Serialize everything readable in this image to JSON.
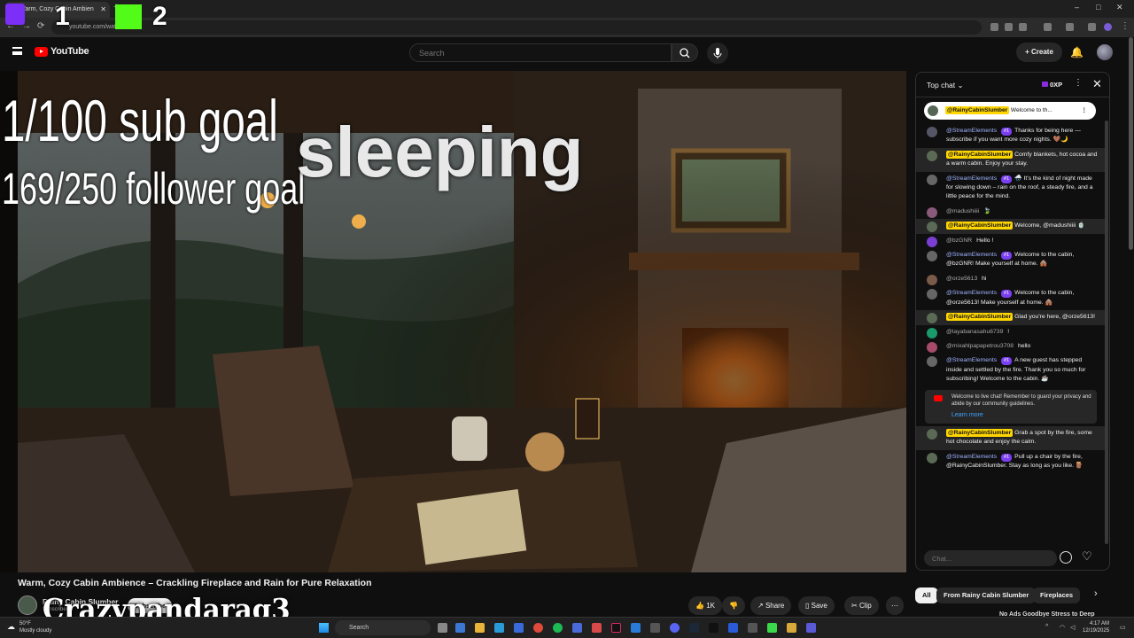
{
  "browser": {
    "tab_title": "Warm, Cozy Cabin Ambien",
    "url": "youtube.com/watch?v=...",
    "new_tab": "+",
    "window_controls": [
      "–",
      "□",
      "✕"
    ]
  },
  "overlay_top": {
    "twitch_count": "1",
    "kick_count": "2"
  },
  "youtube": {
    "logo_text": "YouTube",
    "search_placeholder": "Search",
    "create_label": "+ Create"
  },
  "video_overlay": {
    "sub_goal": "1/100 sub goal",
    "follower_goal": "169/250 follower goal",
    "status": "sleeping",
    "watermark": "Crazypandarag3"
  },
  "video": {
    "title": "Warm, Cozy Cabin Ambience – Crackling Fireplace and Rain for Pure Relaxation",
    "channel": "Rainy Cabin Slumber",
    "subscribers": "Subscribers",
    "subscribe_label": "Subscribe",
    "actions": {
      "likes": "1K",
      "share": "Share",
      "save": "Save",
      "clip": "Clip",
      "more": "⋯"
    }
  },
  "chat": {
    "header": "Top chat",
    "xp": "0XP",
    "pinned_author": "@RainyCabinSlumber",
    "pinned_text": "Welcome to th...",
    "messages": [
      {
        "author": "@StreamElements",
        "bot": true,
        "rank": "#1",
        "text": "Thanks for being here — subscribe if you want more cozy nights. 🤎🌙",
        "hl": false
      },
      {
        "author": "@RainyCabinSlumber",
        "owner": true,
        "text": "Comfy blankets, hot cocoa and a warm cabin. Enjoy your stay.",
        "hl": true
      },
      {
        "author": "@StreamElements",
        "bot": true,
        "rank": "#1",
        "text": "🌧️ It's the kind of night made for slowing down – rain on the roof, a steady fire, and a little peace for the mind.",
        "hl": false
      },
      {
        "author": "@madushiiii",
        "text": "🍃",
        "hl": false
      },
      {
        "author": "@RainyCabinSlumber",
        "owner": true,
        "text": "Welcome, @madushiiii 🍵",
        "hl": true
      },
      {
        "author": "@bzGNR",
        "text": "Hello !",
        "hl": false
      },
      {
        "author": "@StreamElements",
        "bot": true,
        "rank": "#1",
        "text": "Welcome to the cabin, @bzGNR! Make yourself at home. 🛖",
        "hl": false
      },
      {
        "author": "@orze5613",
        "text": "hi",
        "hl": false
      },
      {
        "author": "@StreamElements",
        "bot": true,
        "rank": "#1",
        "text": "Welcome to the cabin, @orze5613! Make yourself at home. 🛖",
        "hl": false
      },
      {
        "author": "@RainyCabinSlumber",
        "owner": true,
        "text": "Glad you're here, @orze5613!",
        "hl": true
      },
      {
        "author": "@layabanasahu6739",
        "text": "!",
        "hl": false
      },
      {
        "author": "@mixahlpapapetrou3708",
        "text": "hello",
        "hl": false
      },
      {
        "author": "@StreamElements",
        "bot": true,
        "rank": "#1",
        "text": "A new guest has stepped inside and settled by the fire. Thank you so much for subscribing! Welcome to the cabin. ☕",
        "hl": false
      }
    ],
    "notice": "Welcome to live chat! Remember to guard your privacy and abide by our community guidelines.",
    "notice_link": "Learn more",
    "messages2": [
      {
        "author": "@RainyCabinSlumber",
        "owner": true,
        "text": "Grab a spot by the fire, some hot chocolate and enjoy the calm.",
        "hl": true
      },
      {
        "author": "@StreamElements",
        "bot": true,
        "rank": "#1",
        "text": "Pull up a chair by the fire, @RainyCabinSlumber. Stay as long as you like. 🪵",
        "hl": false
      }
    ],
    "input_placeholder": "Chat..."
  },
  "chips": [
    "All",
    "From Rainy Cabin Slumber",
    "Fireplaces"
  ],
  "next_video": "No Ads Goodbye Stress to Deep",
  "taskbar": {
    "weather_temp": "50°F",
    "weather_desc": "Mostly cloudy",
    "search": "Search",
    "time": "4:17 AM",
    "date": "12/19/2025"
  }
}
